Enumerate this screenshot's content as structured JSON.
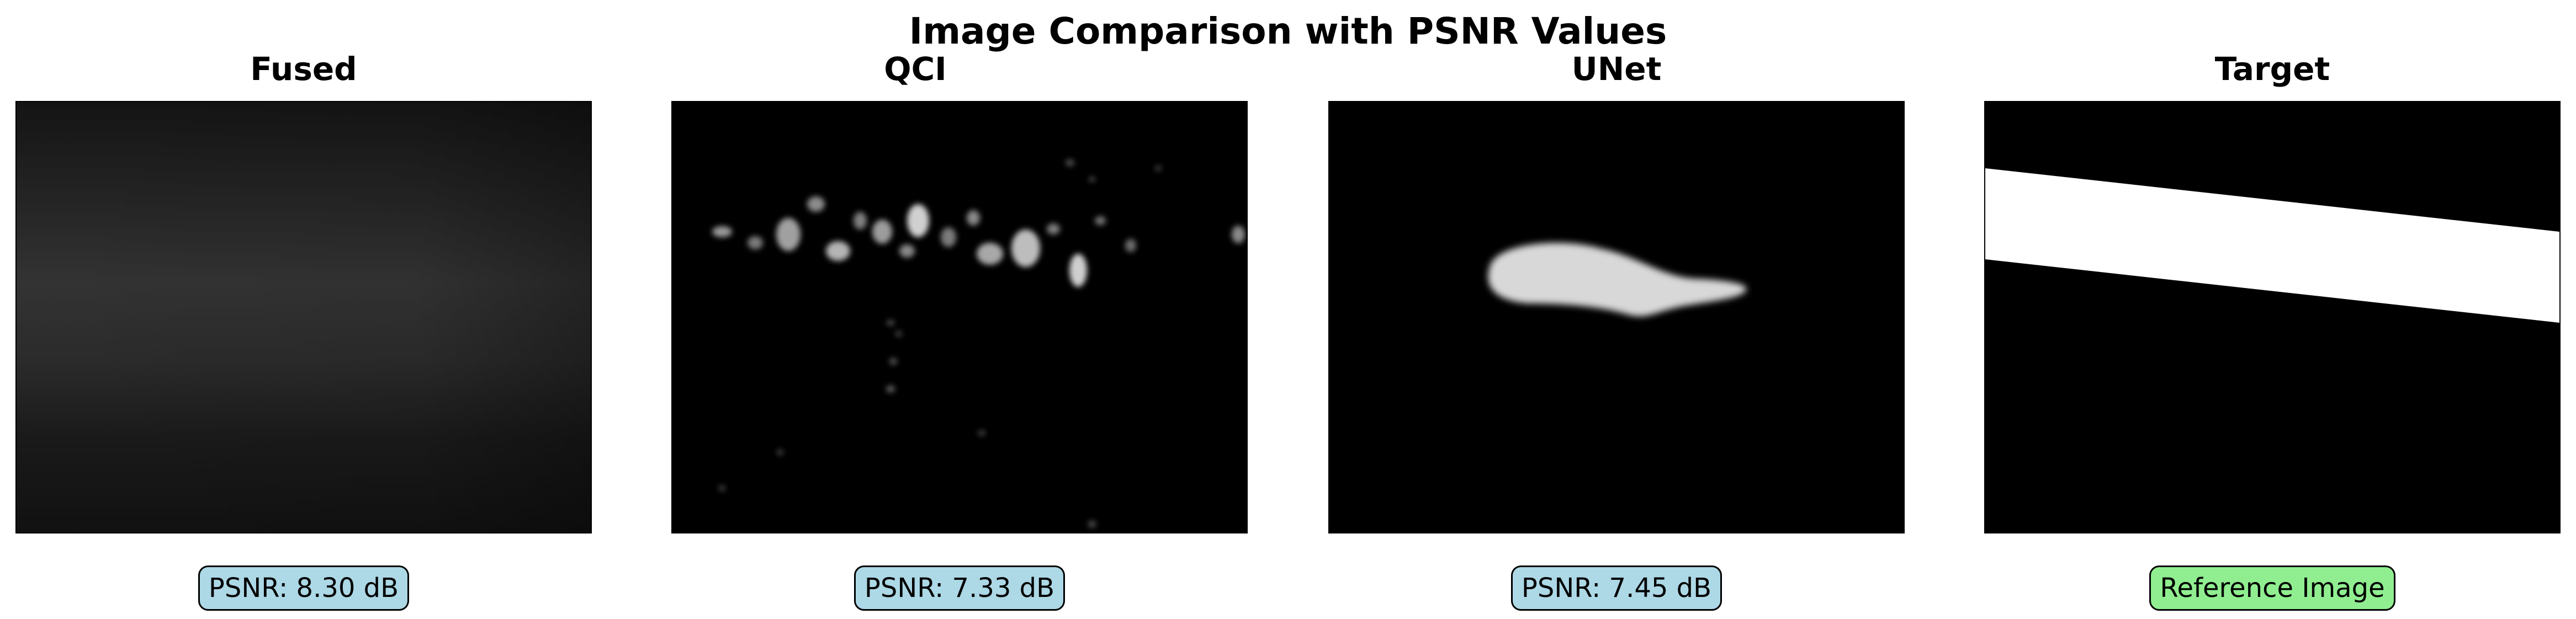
{
  "figure": {
    "title": "Image Comparison with PSNR Values"
  },
  "panels": [
    {
      "title": "Fused",
      "caption": "PSNR: 8.30 dB",
      "caption_color": "#add8e6"
    },
    {
      "title": "QCI",
      "caption": "PSNR: 7.33 dB",
      "caption_color": "#add8e6"
    },
    {
      "title": "UNet",
      "caption": "PSNR: 7.45 dB",
      "caption_color": "#add8e6"
    },
    {
      "title": "Target",
      "caption": "Reference Image",
      "caption_color": "#90ee90"
    }
  ]
}
